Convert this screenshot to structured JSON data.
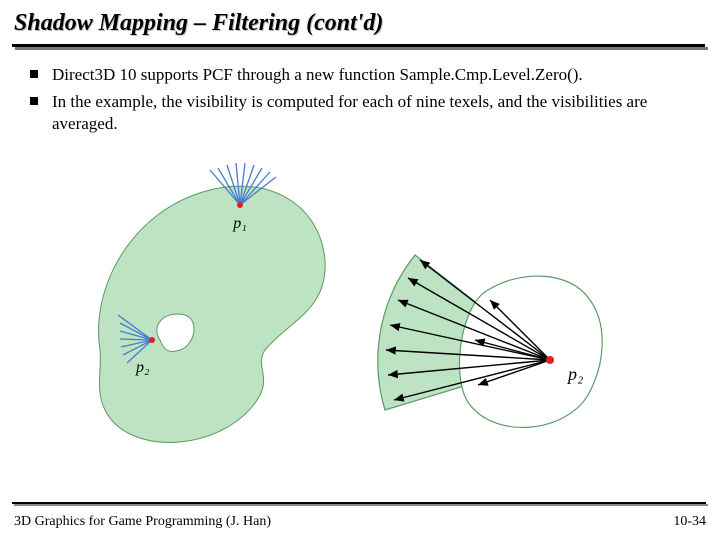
{
  "title": "Shadow Mapping – Filtering (cont'd)",
  "bullets": [
    "Direct3D 10 supports PCF through a new function Sample.Cmp.Level.Zero().",
    "In the example, the visibility is computed for each of nine texels, and the visibilities are averaged."
  ],
  "figure": {
    "p1_label": "p₁",
    "p2_label": "p₂",
    "p2b_label": "p₂"
  },
  "footer": {
    "left": "3D Graphics for Game Programming (J. Han)",
    "right": "10-34"
  }
}
